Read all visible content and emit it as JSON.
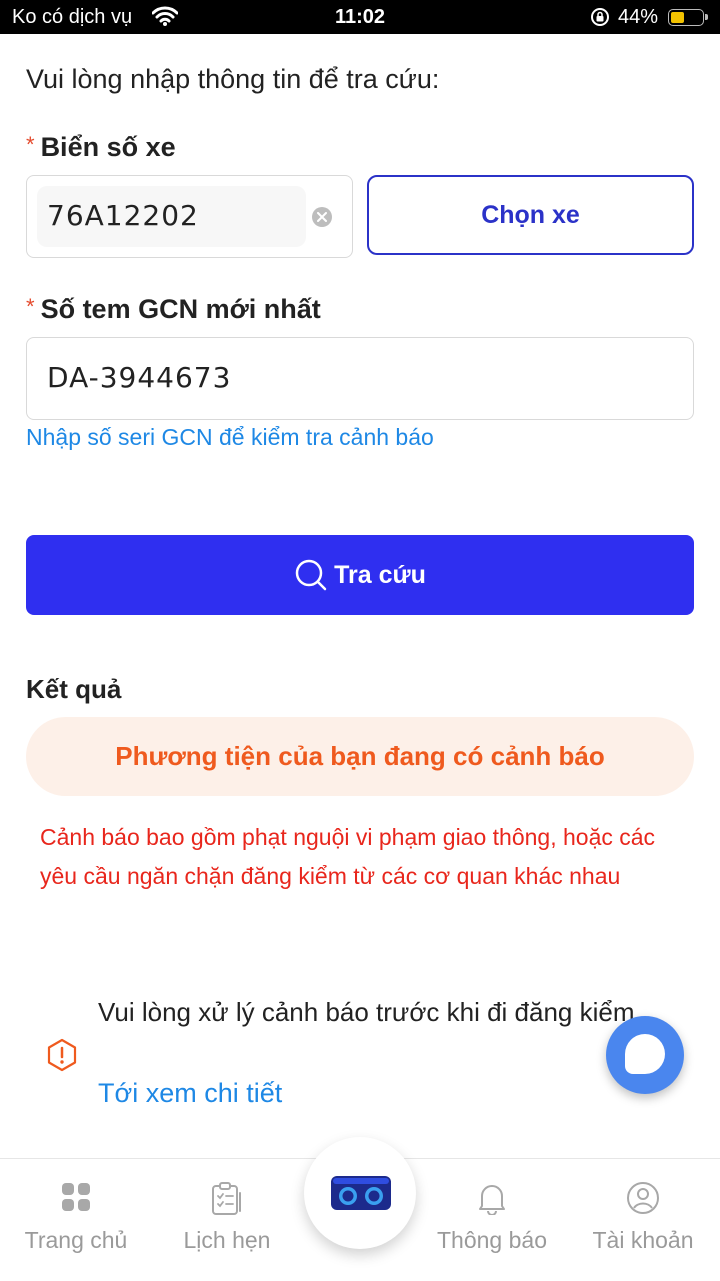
{
  "status_bar": {
    "carrier": "Ko có dịch vụ",
    "time": "11:02",
    "battery": "44%",
    "battery_level": 0.44
  },
  "form": {
    "prompt": "Vui lòng nhập thông tin để tra cứu:",
    "required_mark": "*",
    "plate_label": "Biển số xe",
    "plate_value": "76A12202",
    "choose_vehicle_label": "Chọn xe",
    "cert_label": "Số tem GCN mới nhất",
    "cert_value": "DA-3944673",
    "cert_hint": "Nhập số seri GCN để kiểm tra cảnh báo",
    "search_label": "Tra cứu"
  },
  "result": {
    "title": "Kết quả",
    "warning_banner": "Phương tiện của bạn đang có cảnh báo",
    "warning_desc": "Cảnh báo bao gồm phạt nguội vi phạm giao thông, hoặc các yêu cầu ngăn chặn đăng kiểm từ các cơ quan khác nhau",
    "alert_text": "Vui lòng xử lý cảnh báo trước khi đi đăng kiểm.",
    "detail_link": "Tới xem chi tiết"
  },
  "bottom_nav": {
    "items": [
      {
        "label": "Trang chủ",
        "icon": "grid-icon"
      },
      {
        "label": "Lịch hẹn",
        "icon": "clipboard-icon"
      },
      {
        "label": "Thông báo",
        "icon": "bell-icon"
      },
      {
        "label": "Tài khoản",
        "icon": "user-icon"
      }
    ],
    "center_icon": "goggles-icon"
  },
  "colors": {
    "primary": "#2f2ff0",
    "link": "#1e88e5",
    "warning": "#ef5a1e",
    "danger": "#e8261c"
  }
}
